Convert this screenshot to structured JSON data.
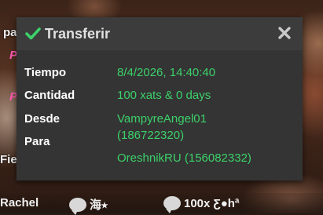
{
  "background": {
    "fragments": [
      "pa",
      "Fie"
    ],
    "pink_letters": [
      "P",
      "P",
      "P",
      "P"
    ],
    "bottom": {
      "name": "Rachel",
      "item2_text": "海⭑",
      "item3_text": "100x Ƹ●hª"
    }
  },
  "dialog": {
    "title": "Transferir",
    "icon": "check-icon",
    "close_icon": "close-icon",
    "rows": {
      "tiempo": {
        "label": "Tiempo",
        "value": "8/4/2026, 14:40:40"
      },
      "cantidad": {
        "label": "Cantidad",
        "value": "100 xats & 0 days"
      },
      "desde": {
        "label": "Desde",
        "value_line1": "VampyreAngel01",
        "value_line2": "(186722320)"
      },
      "para": {
        "label": "Para",
        "value": "OreshnikRU (156082332)"
      }
    }
  },
  "colors": {
    "accent_green": "#3cd16a",
    "dialog_bg": "#343434",
    "header_bg": "#3c3c3c"
  }
}
